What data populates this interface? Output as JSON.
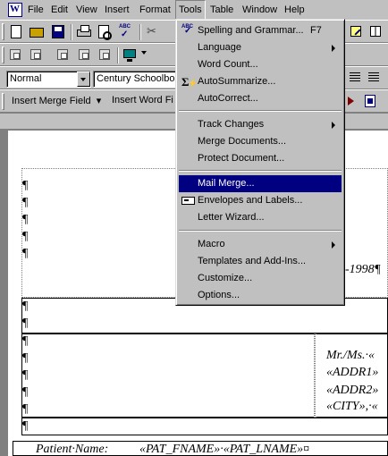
{
  "menubar": {
    "items": [
      {
        "label": "File"
      },
      {
        "label": "Edit"
      },
      {
        "label": "View"
      },
      {
        "label": "Insert"
      },
      {
        "label": "Format"
      },
      {
        "label": "Tools"
      },
      {
        "label": "Table"
      },
      {
        "label": "Window"
      },
      {
        "label": "Help"
      }
    ]
  },
  "formatting": {
    "style_value": "Normal",
    "font_value": "Century Schoolboo"
  },
  "mailmerge_toolbar": {
    "insert_merge_field": "Insert Merge Field",
    "insert_word_field": "Insert Word Fi"
  },
  "tools_menu": {
    "items": [
      {
        "label": "Spelling and Grammar...",
        "shortcut": "F7",
        "icon": "spelling-icon"
      },
      {
        "label": "Language",
        "submenu": true
      },
      {
        "label": "Word Count..."
      },
      {
        "label": "AutoSummarize...",
        "icon": "autosummarize-icon"
      },
      {
        "label": "AutoCorrect..."
      },
      {
        "label": "Track Changes",
        "submenu": true
      },
      {
        "label": "Merge Documents..."
      },
      {
        "label": "Protect Document..."
      },
      {
        "label": "Mail Merge...",
        "highlighted": true
      },
      {
        "label": "Envelopes and Labels...",
        "icon": "envelope-icon"
      },
      {
        "label": "Letter Wizard..."
      },
      {
        "label": "Macro",
        "submenu": true
      },
      {
        "label": "Templates and Add-Ins..."
      },
      {
        "label": "Customize..."
      },
      {
        "label": "Options..."
      }
    ]
  },
  "document": {
    "pilcrow": "¶",
    "date_fragment": "-1998¶",
    "address_lines": [
      "Mr./Ms.·«",
      "«ADDR1»",
      "«ADDR2»",
      "«CITY»,·«"
    ],
    "patient_label": "Patient·Name:",
    "patient_value": "«PAT_FNAME»·«PAT_LNAME»¤"
  },
  "colors": {
    "menu_highlight": "#000080",
    "face": "#c0c0c0"
  }
}
